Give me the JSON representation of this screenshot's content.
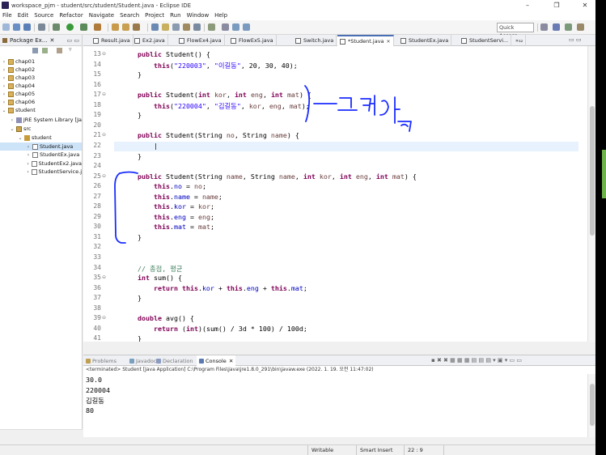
{
  "window": {
    "title": "workspace_pjm - student/src/student/Student.java - Eclipse IDE",
    "controls": [
      "–",
      "❐",
      "✕"
    ]
  },
  "menu": [
    "File",
    "Edit",
    "Source",
    "Refactor",
    "Navigate",
    "Search",
    "Project",
    "Run",
    "Window",
    "Help"
  ],
  "toolbar": {
    "quick_access_placeholder": "Quick Access"
  },
  "package_explorer": {
    "title": "Package Ex...",
    "close": "✕",
    "items": [
      {
        "label": "chap01",
        "icon": "project-icon"
      },
      {
        "label": "chap02",
        "icon": "project-icon"
      },
      {
        "label": "chap03",
        "icon": "project-icon"
      },
      {
        "label": "chap04",
        "icon": "project-icon"
      },
      {
        "label": "chap05",
        "icon": "project-icon"
      },
      {
        "label": "chap06",
        "icon": "project-icon"
      },
      {
        "label": "student",
        "icon": "project-icon"
      },
      {
        "label": "JRE System Library [Ja",
        "icon": "library-icon"
      },
      {
        "label": "src",
        "icon": "source-folder-icon"
      },
      {
        "label": "student",
        "icon": "package-icon"
      },
      {
        "label": "Student.java",
        "icon": "java-file-icon"
      },
      {
        "label": "StudentEx.java",
        "icon": "java-file-icon"
      },
      {
        "label": "StudentEx2.java",
        "icon": "java-file-icon"
      },
      {
        "label": "StudentService.j",
        "icon": "java-file-icon"
      }
    ]
  },
  "editor_tabs": [
    {
      "label": "Result.java"
    },
    {
      "label": "Ex2.java"
    },
    {
      "label": "FlowEx4.java"
    },
    {
      "label": "FlowEx5.java"
    },
    {
      "label": "Switch.java"
    },
    {
      "label": "*Student.java"
    },
    {
      "label": "StudentEx.java"
    },
    {
      "label": "StudentServi..."
    },
    {
      "label": "»₃₂"
    }
  ],
  "editor": {
    "lines": [
      {
        "n": "13",
        "fold": "⊖",
        "html": "    <span class=\"kw\">public</span> Student() {"
      },
      {
        "n": "14",
        "fold": "",
        "html": "        <span class=\"kw\">this</span>(<span class=\"str\">\"220003\"</span>, <span class=\"str\">\"이길동\"</span>, 20, 30, 40);"
      },
      {
        "n": "15",
        "fold": "",
        "html": "    }"
      },
      {
        "n": "16",
        "fold": "",
        "html": ""
      },
      {
        "n": "17",
        "fold": "⊖",
        "html": "    <span class=\"kw\">public</span> Student(<span class=\"kw\">int</span> <span class=\"par\">kor</span>, <span class=\"kw\">int</span> <span class=\"par\">eng</span>, <span class=\"kw\">int</span> <span class=\"par\">mat</span>) {"
      },
      {
        "n": "18",
        "fold": "",
        "html": "        <span class=\"kw\">this</span>(<span class=\"str\">\"220004\"</span>, <span class=\"str\">\"김길동\"</span>, <span class=\"par\">kor</span>, <span class=\"par\">eng</span>, <span class=\"par\">mat</span>);"
      },
      {
        "n": "19",
        "fold": "",
        "html": "    }"
      },
      {
        "n": "20",
        "fold": "",
        "html": ""
      },
      {
        "n": "21",
        "fold": "⊖",
        "html": "    <span class=\"kw\">public</span> Student(String <span class=\"par\">no</span>, String <span class=\"par\">name</span>) {"
      },
      {
        "n": "22",
        "fold": "",
        "html": "        |"
      },
      {
        "n": "23",
        "fold": "",
        "html": "    }"
      },
      {
        "n": "24",
        "fold": "",
        "html": ""
      },
      {
        "n": "25",
        "fold": "⊖",
        "html": "    <span class=\"kw\">public</span> Student(String <span class=\"par\">name</span>, String <span class=\"par\">name</span>, <span class=\"kw\">int</span> <span class=\"par\">kor</span>, <span class=\"kw\">int</span> <span class=\"par\">eng</span>, <span class=\"kw\">int</span> <span class=\"par\">mat</span>) {"
      },
      {
        "n": "26",
        "fold": "",
        "html": "        <span class=\"kw\">this</span>.<span class=\"fld\">no</span> = <span class=\"par\">no</span>;"
      },
      {
        "n": "27",
        "fold": "",
        "html": "        <span class=\"kw\">this</span>.<span class=\"fld\">name</span> = <span class=\"par\">name</span>;"
      },
      {
        "n": "28",
        "fold": "",
        "html": "        <span class=\"kw\">this</span>.<span class=\"fld\">kor</span> = <span class=\"par\">kor</span>;"
      },
      {
        "n": "29",
        "fold": "",
        "html": "        <span class=\"kw\">this</span>.<span class=\"fld\">eng</span> = <span class=\"par\">eng</span>;"
      },
      {
        "n": "30",
        "fold": "",
        "html": "        <span class=\"kw\">this</span>.<span class=\"fld\">mat</span> = <span class=\"par\">mat</span>;"
      },
      {
        "n": "31",
        "fold": "",
        "html": "    }"
      },
      {
        "n": "32",
        "fold": "",
        "html": ""
      },
      {
        "n": "33",
        "fold": "",
        "html": ""
      },
      {
        "n": "34",
        "fold": "",
        "html": "    <span class=\"cmt\">// 총점, 평균</span>"
      },
      {
        "n": "35",
        "fold": "⊖",
        "html": "    <span class=\"kw\">int</span> sum() {"
      },
      {
        "n": "36",
        "fold": "",
        "html": "        <span class=\"kw\">return</span> <span class=\"kw\">this</span>.<span class=\"fld\">kor</span> + <span class=\"kw\">this</span>.<span class=\"fld\">eng</span> + <span class=\"kw\">this</span>.<span class=\"fld\">mat</span>;"
      },
      {
        "n": "37",
        "fold": "",
        "html": "    }"
      },
      {
        "n": "38",
        "fold": "",
        "html": ""
      },
      {
        "n": "39",
        "fold": "⊖",
        "html": "    <span class=\"kw\">double</span> avg() {"
      },
      {
        "n": "40",
        "fold": "",
        "html": "        <span class=\"kw\">return</span> (<span class=\"kw\">int</span>)(sum() / 3d * 100) / 100d;"
      },
      {
        "n": "41",
        "fold": "",
        "html": "    }"
      }
    ]
  },
  "console_tabs": [
    {
      "label": "Problems",
      "active": false
    },
    {
      "label": "Javadoc",
      "active": false
    },
    {
      "label": "Declaration",
      "active": false
    },
    {
      "label": "Console",
      "active": true
    }
  ],
  "console": {
    "close": "✕",
    "status": "<terminated> Student [Java Application] C:\\Program Files\\Java\\jre1.8.0_291\\bin\\javaw.exe (2022. 1. 19. 오전 11:47:02)",
    "output": [
      "30.0",
      "220004",
      "김길동",
      "80"
    ]
  },
  "statusbar": {
    "writable": "Writable",
    "insert_mode": "Smart Insert",
    "position": "22 : 9"
  },
  "annotation": {
    "handwriting": "고정값",
    "color": "#1a2cff"
  }
}
